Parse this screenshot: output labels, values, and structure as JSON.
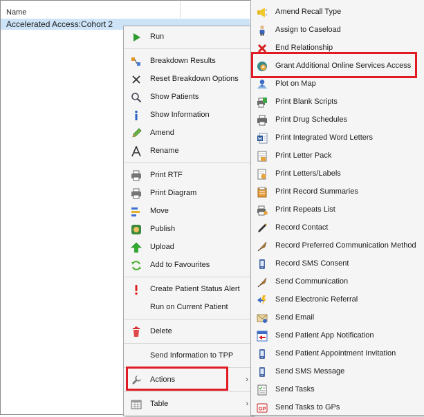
{
  "list": {
    "column_header": "Name",
    "selected_row": "Accelerated Access:Cohort 2"
  },
  "main_menu": {
    "run": "Run",
    "breakdown_results": "Breakdown Results",
    "reset_breakdown": "Reset Breakdown Options",
    "show_patients": "Show Patients",
    "show_information": "Show Information",
    "amend": "Amend",
    "rename": "Rename",
    "print_rtf": "Print RTF",
    "print_diagram": "Print Diagram",
    "move": "Move",
    "publish": "Publish",
    "upload": "Upload",
    "add_favourites": "Add to Favourites",
    "create_alert": "Create Patient Status Alert",
    "run_current": "Run on Current Patient",
    "delete": "Delete",
    "send_info_tpp": "Send Information to TPP",
    "actions": "Actions",
    "table": "Table",
    "submenu_arrow": "›"
  },
  "actions_menu": {
    "items": [
      "Amend Recall Type",
      "Assign to Caseload",
      "End Relationship",
      "Grant Additional Online Services Access",
      "Plot on Map",
      "Print Blank Scripts",
      "Print Drug Schedules",
      "Print Integrated Word Letters",
      "Print Letter Pack",
      "Print Letters/Labels",
      "Print Record Summaries",
      "Print Repeats List",
      "Record Contact",
      "Record Preferred Communication Method",
      "Record SMS Consent",
      "Send Communication",
      "Send Electronic Referral",
      "Send Email",
      "Send Patient App Notification",
      "Send Patient Appointment Invitation",
      "Send SMS Message",
      "Send Tasks",
      "Send Tasks to GPs"
    ]
  },
  "highlight_color": "#e01b24",
  "selection_color": "#cde3f7"
}
